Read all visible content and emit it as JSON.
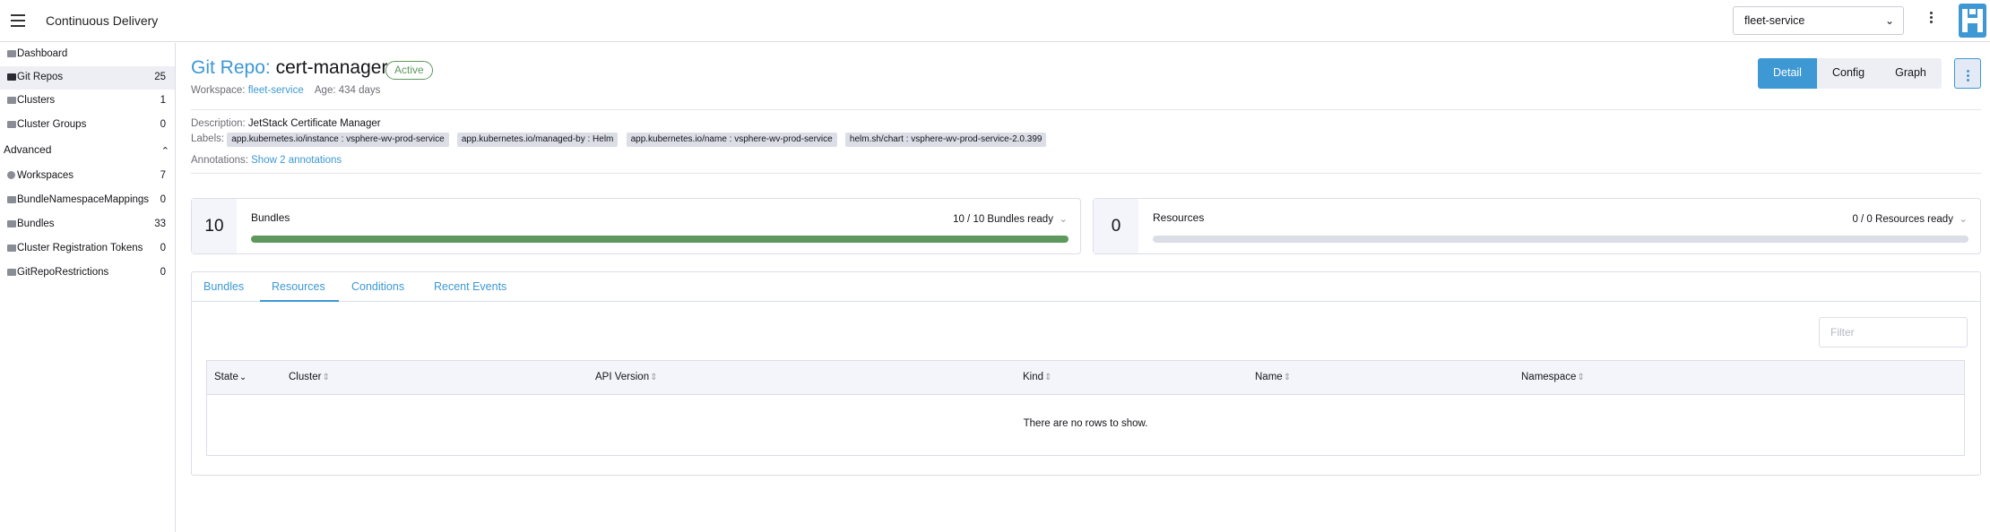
{
  "header": {
    "app_title": "Continuous Delivery",
    "workspace_select": "fleet-service"
  },
  "sidebar": {
    "items": [
      {
        "label": "Dashboard",
        "count": ""
      },
      {
        "label": "Git Repos",
        "count": "25"
      },
      {
        "label": "Clusters",
        "count": "1"
      },
      {
        "label": "Cluster Groups",
        "count": "0"
      }
    ],
    "advanced_label": "Advanced",
    "advanced_items": [
      {
        "label": "Workspaces",
        "count": "7"
      },
      {
        "label": "BundleNamespaceMappings",
        "count": "0"
      },
      {
        "label": "Bundles",
        "count": "33"
      },
      {
        "label": "Cluster Registration Tokens",
        "count": "0"
      },
      {
        "label": "GitRepoRestrictions",
        "count": "0"
      }
    ]
  },
  "page": {
    "type_label": "Git Repo:",
    "name": "cert-manager",
    "status": "Active",
    "workspace_label": "Workspace:",
    "workspace_value": "fleet-service",
    "age_label": "Age:",
    "age_value": "434 days",
    "view_buttons": [
      "Detail",
      "Config",
      "Graph"
    ]
  },
  "details": {
    "description_label": "Description:",
    "description_value": "JetStack Certificate Manager",
    "labels_label": "Labels:",
    "labels": [
      "app.kubernetes.io/instance : vsphere-wv-prod-service",
      "app.kubernetes.io/managed-by : Helm",
      "app.kubernetes.io/name : vsphere-wv-prod-service",
      "helm.sh/chart : vsphere-wv-prod-service-2.0.399"
    ],
    "annotations_label": "Annotations:",
    "annotations_link": "Show 2 annotations"
  },
  "bundles_card": {
    "count": "10",
    "title": "Bundles",
    "ready_text": "10 / 10 Bundles ready",
    "progress": 1.0
  },
  "resources_card": {
    "count": "0",
    "title": "Resources",
    "ready_text": "0 / 0 Resources ready",
    "progress": 0
  },
  "tabs": [
    "Bundles",
    "Resources",
    "Conditions",
    "Recent Events"
  ],
  "active_tab": "Resources",
  "filter_placeholder": "Filter",
  "table": {
    "columns": [
      "State",
      "Cluster",
      "API Version",
      "Kind",
      "Name",
      "Namespace"
    ],
    "empty_text": "There are no rows to show."
  },
  "colors": {
    "accent": "#3d98d3",
    "success": "#5d995d"
  }
}
